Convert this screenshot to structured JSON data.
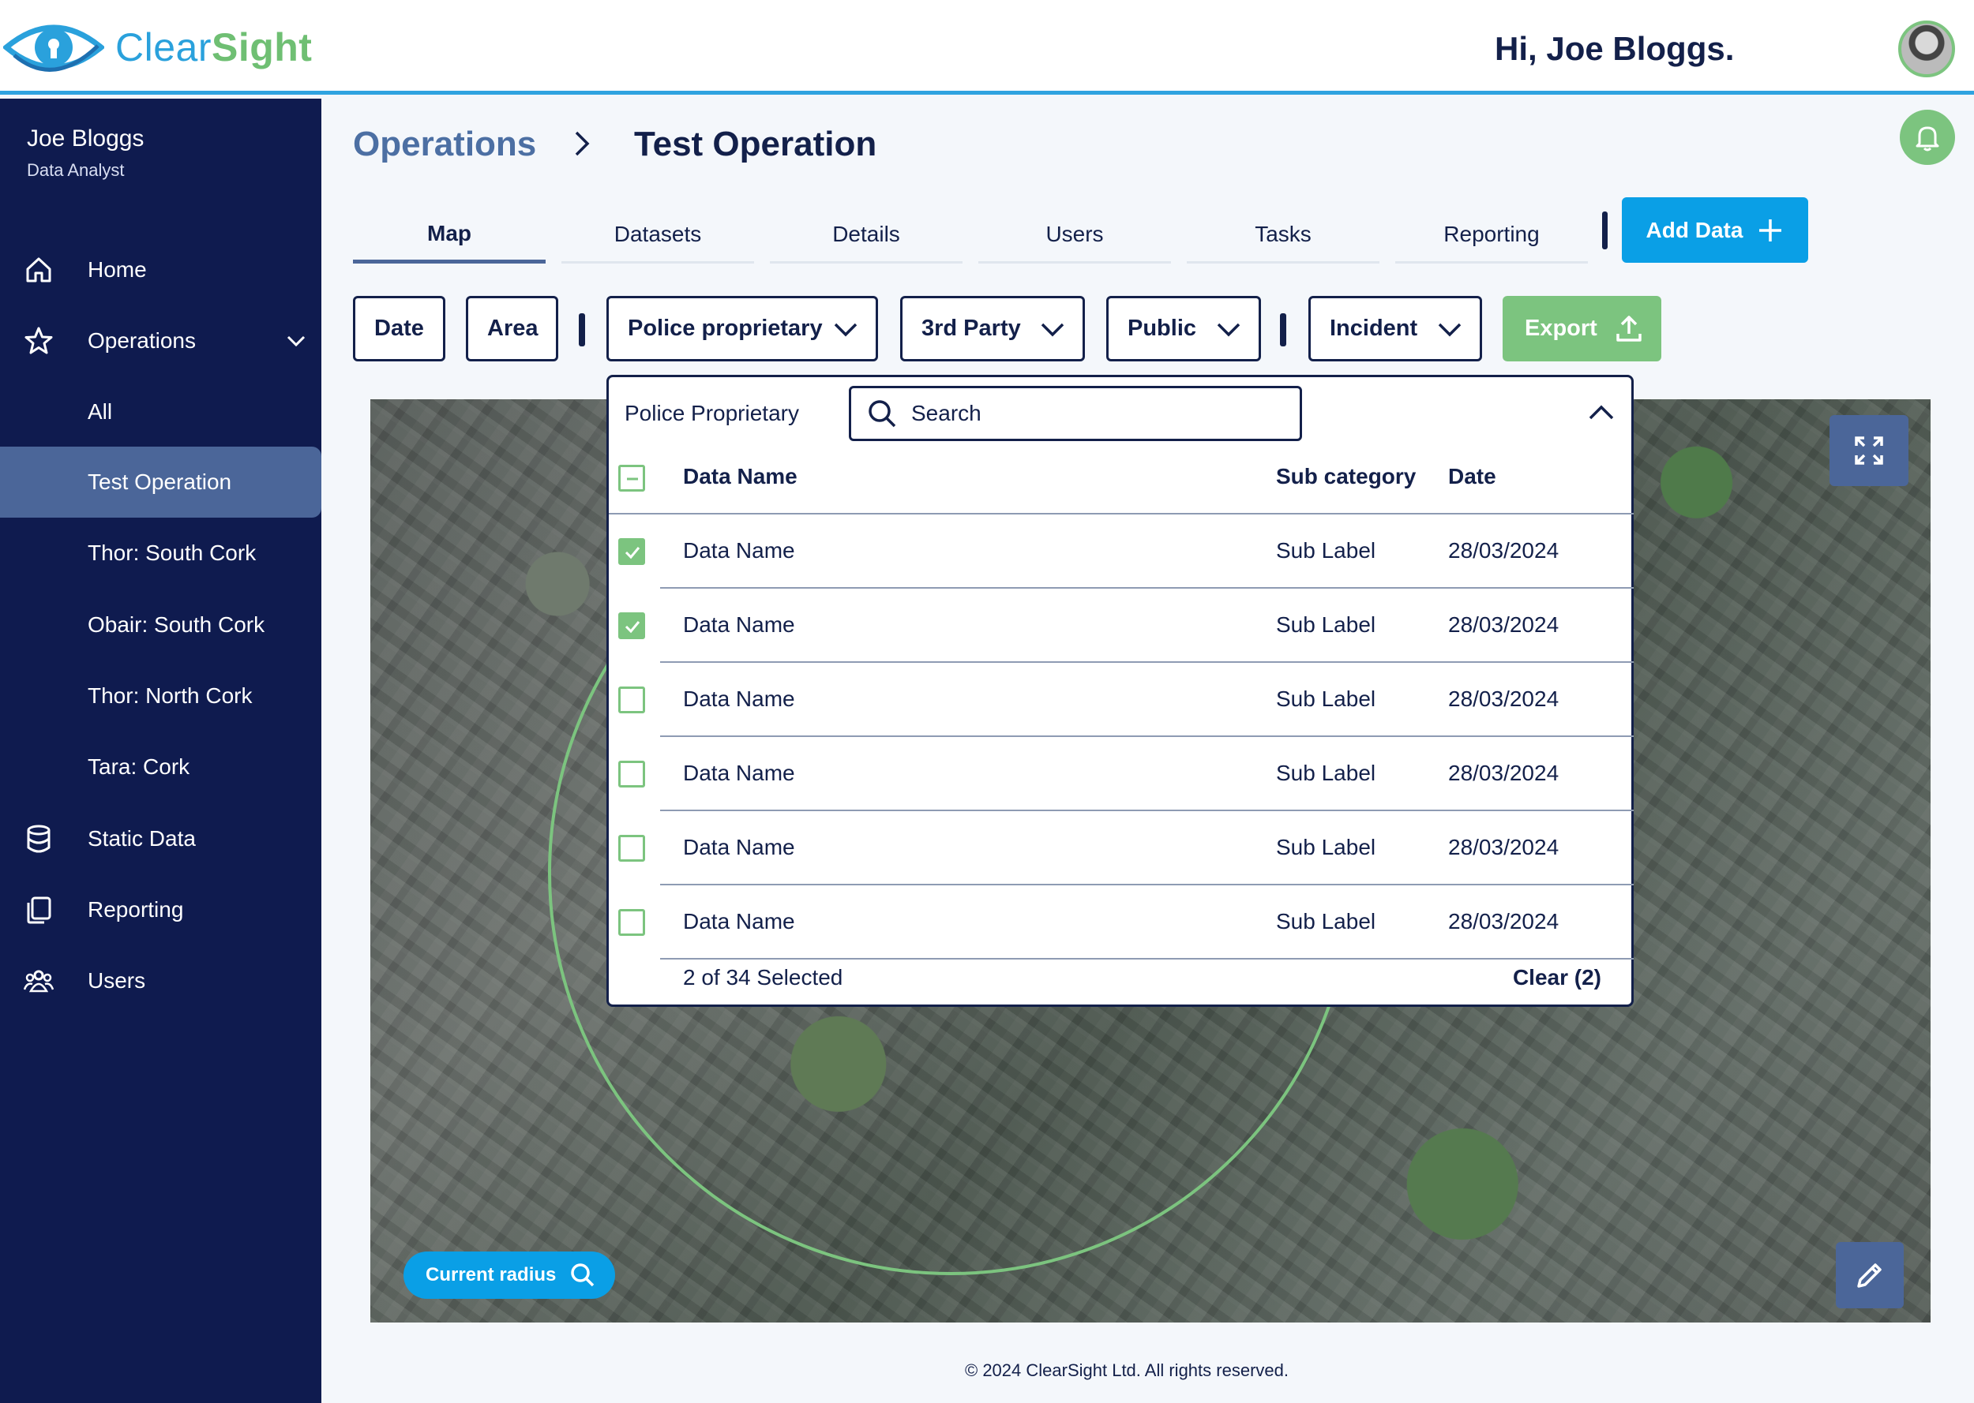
{
  "app": {
    "name_part1": "Clear",
    "name_part2": "Sight",
    "greeting": "Hi, Joe Bloggs."
  },
  "user": {
    "name": "Joe Bloggs",
    "role": "Data Analyst"
  },
  "sidebar": {
    "items": [
      {
        "label": "Home",
        "icon": "home-icon"
      },
      {
        "label": "Operations",
        "icon": "star-icon"
      },
      {
        "label": "All"
      },
      {
        "label": "Test Operation"
      },
      {
        "label": "Thor: South Cork"
      },
      {
        "label": "Obair: South Cork"
      },
      {
        "label": "Thor: North Cork"
      },
      {
        "label": "Tara: Cork"
      },
      {
        "label": "Static Data",
        "icon": "database-icon"
      },
      {
        "label": "Reporting",
        "icon": "documents-icon"
      },
      {
        "label": "Users",
        "icon": "users-icon"
      }
    ]
  },
  "breadcrumb": {
    "parent": "Operations",
    "current": "Test Operation"
  },
  "tabs": [
    "Map",
    "Datasets",
    "Details",
    "Users",
    "Tasks",
    "Reporting"
  ],
  "actions": {
    "add_data": "Add Data",
    "export": "Export"
  },
  "filters": {
    "date": "Date",
    "area": "Area",
    "police": "Police proprietary",
    "third_party": "3rd Party",
    "public": "Public",
    "incident": "Incident"
  },
  "map": {
    "current_radius": "Current radius"
  },
  "dropdown": {
    "title": "Police Proprietary",
    "search_placeholder": "Search",
    "headers": {
      "name": "Data Name",
      "sub": "Sub category",
      "date": "Date"
    },
    "rows": [
      {
        "name": "Data Name",
        "sub": "Sub Label",
        "date": "28/03/2024",
        "checked": true
      },
      {
        "name": "Data Name",
        "sub": "Sub Label",
        "date": "28/03/2024",
        "checked": true
      },
      {
        "name": "Data Name",
        "sub": "Sub Label",
        "date": "28/03/2024",
        "checked": false
      },
      {
        "name": "Data Name",
        "sub": "Sub Label",
        "date": "28/03/2024",
        "checked": false
      },
      {
        "name": "Data Name",
        "sub": "Sub Label",
        "date": "28/03/2024",
        "checked": false
      },
      {
        "name": "Data Name",
        "sub": "Sub Label",
        "date": "28/03/2024",
        "checked": false
      }
    ],
    "selected_summary": "2 of 34 Selected",
    "clear_label": "Clear (2)"
  },
  "footer": "© 2024 ClearSight Ltd. All rights reserved.",
  "colors": {
    "navy": "#0f1b4f",
    "accent_blue": "#0a9fe6",
    "green": "#7cc47f",
    "active_nav": "#4b6699"
  }
}
